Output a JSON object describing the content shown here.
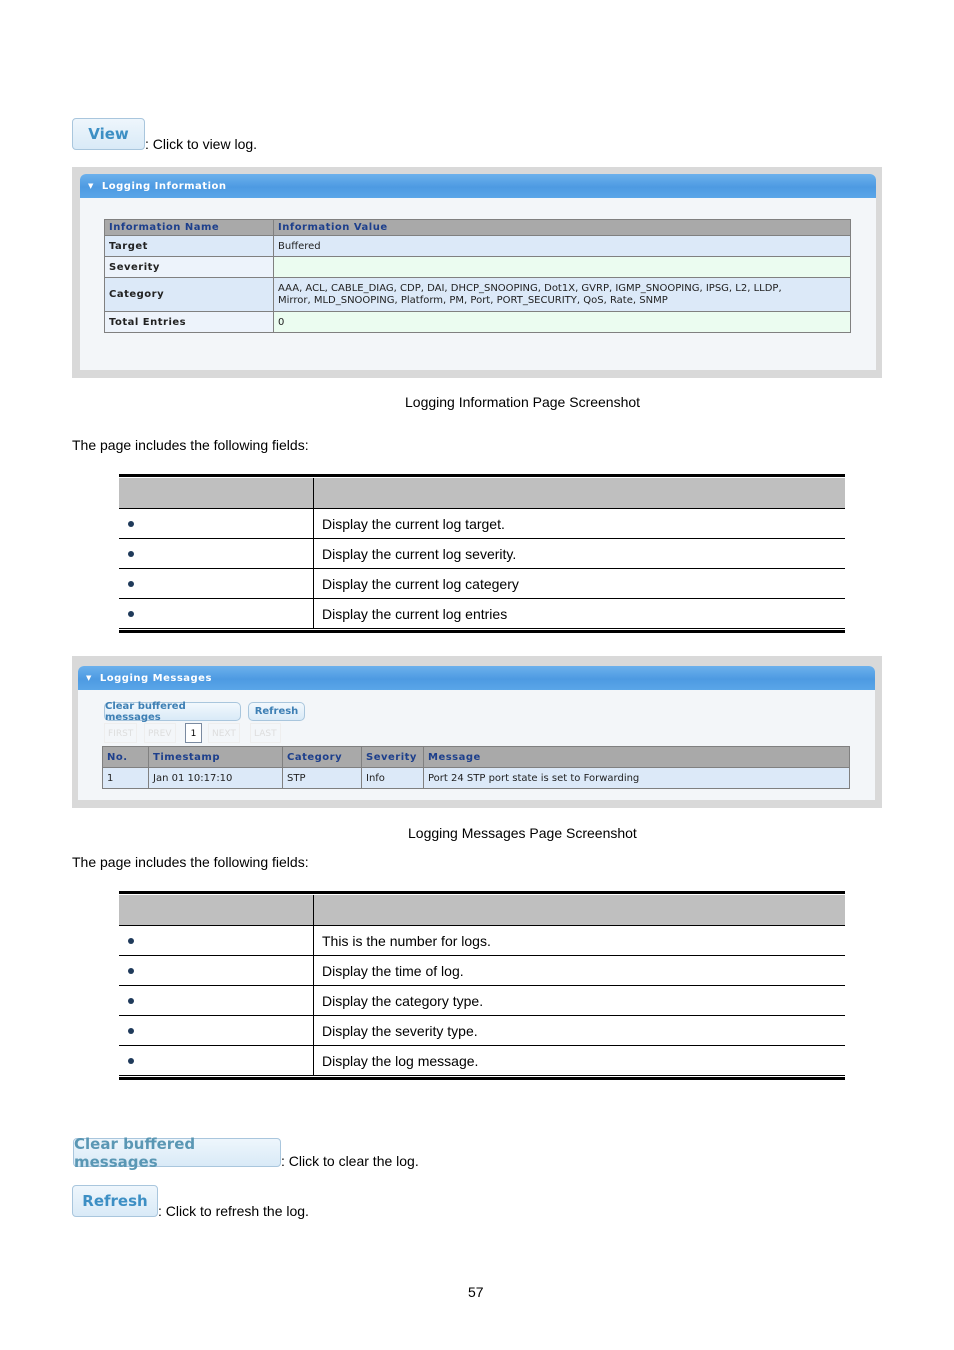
{
  "view_button": {
    "label": "View",
    "desc": ": Click to view log."
  },
  "logging_info_panel": {
    "title": "Logging Information",
    "columns": [
      "Information Name",
      "Information Value"
    ],
    "rows": [
      {
        "name": "Target",
        "value": "Buffered"
      },
      {
        "name": "Severity",
        "value": ""
      },
      {
        "name": "Category",
        "value_line1": "AAA, ACL, CABLE_DIAG, CDP, DAI, DHCP_SNOOPING, Dot1X, GVRP, IGMP_SNOOPING, IPSG, L2, LLDP,",
        "value_line2": "Mirror, MLD_SNOOPING, Platform, PM, Port, PORT_SECURITY, QoS, Rate, SNMP"
      },
      {
        "name": "Total Entries",
        "value": "0"
      }
    ]
  },
  "caption1": "Logging Information Page Screenshot",
  "intro1": "The page includes the following fields:",
  "fields1": {
    "header": [
      "",
      ""
    ],
    "rows": [
      {
        "name": "",
        "desc": "Display the current log target."
      },
      {
        "name": "",
        "desc": "Display the current log severity."
      },
      {
        "name": "",
        "desc": "Display the current log categery"
      },
      {
        "name": "",
        "desc": "Display the current log entries"
      }
    ]
  },
  "logging_messages_panel": {
    "title": "Logging Messages",
    "clear_label": "Clear buffered messages",
    "refresh_label": "Refresh",
    "pager": {
      "first": "FIRST",
      "prev": "PREV",
      "current": "1",
      "next": "NEXT",
      "last": "LAST"
    },
    "columns": [
      "No.",
      "Timestamp",
      "Category",
      "Severity",
      "Message"
    ],
    "rows": [
      {
        "no": "1",
        "timestamp": "Jan 01 10:17:10",
        "category": "STP",
        "severity": "Info",
        "message": "Port 24 STP port state is set to Forwarding"
      }
    ]
  },
  "caption2": "Logging Messages Page Screenshot",
  "intro2": "The page includes the following fields:",
  "fields2": {
    "header": [
      "",
      ""
    ],
    "rows": [
      {
        "name": "",
        "desc": "This is the number for logs."
      },
      {
        "name": "",
        "desc": "Display the time of log."
      },
      {
        "name": "",
        "desc": "Display the category type."
      },
      {
        "name": "",
        "desc": "Display the severity type."
      },
      {
        "name": "",
        "desc": "Display the log message."
      }
    ]
  },
  "clear_button": {
    "label": "Clear buffered messages",
    "desc": ": Click to clear the log."
  },
  "refresh_button": {
    "label": "Refresh",
    "desc": ": Click to refresh the log."
  },
  "page_number": "57"
}
